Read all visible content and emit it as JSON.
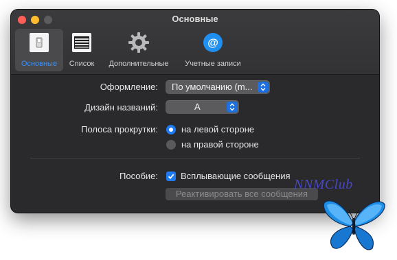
{
  "window": {
    "title": "Основные"
  },
  "toolbar": {
    "tabs": [
      {
        "label": "Основные",
        "icon": "general-switch-icon",
        "active": true
      },
      {
        "label": "Список",
        "icon": "list-icon",
        "active": false
      },
      {
        "label": "Дополнительные",
        "icon": "gear-icon",
        "active": false
      },
      {
        "label": "Учетные записи",
        "icon": "at-sign-icon",
        "active": false
      }
    ]
  },
  "form": {
    "appearance": {
      "label": "Оформление:",
      "value": "По умолчанию (m..."
    },
    "title_design": {
      "label": "Дизайн названий:",
      "value": "A"
    },
    "scrollbar": {
      "label": "Полоса прокрутки:",
      "options": [
        {
          "label": "на левой стороне",
          "selected": true
        },
        {
          "label": "на правой стороне",
          "selected": false
        }
      ]
    },
    "hints": {
      "label": "Пособие:",
      "checkbox_label": "Всплывающие сообщения",
      "checked": true,
      "reactivate_button": "Реактивировать все сообщения"
    }
  },
  "watermark": "NNMClub",
  "colors": {
    "accent": "#1f7af2",
    "window_bg": "#2a2a2c",
    "active_tab_text": "#3b8ff5"
  }
}
